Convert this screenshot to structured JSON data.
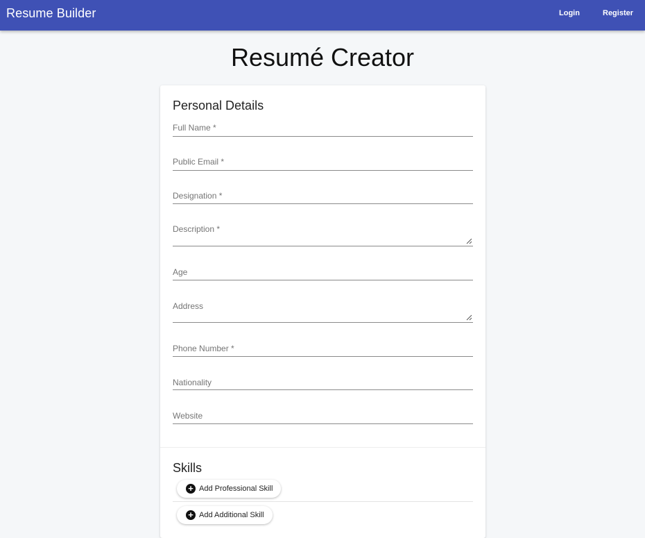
{
  "appbar": {
    "brand": "Resume Builder",
    "login_label": "Login",
    "register_label": "Register"
  },
  "page": {
    "title": "Resumé Creator"
  },
  "personal": {
    "section_title": "Personal Details",
    "fields": {
      "full_name": "Full Name *",
      "public_email": "Public Email *",
      "designation": "Designation *",
      "description": "Description *",
      "age": "Age",
      "address": "Address",
      "phone_number": "Phone Number *",
      "nationality": "Nationality",
      "website": "Website"
    }
  },
  "skills": {
    "section_title": "Skills",
    "add_professional_label": "Add Professional Skill",
    "add_additional_label": "Add Additional Skill"
  },
  "colors": {
    "appbar": "#3f51b5",
    "background": "#f5f7f9"
  }
}
